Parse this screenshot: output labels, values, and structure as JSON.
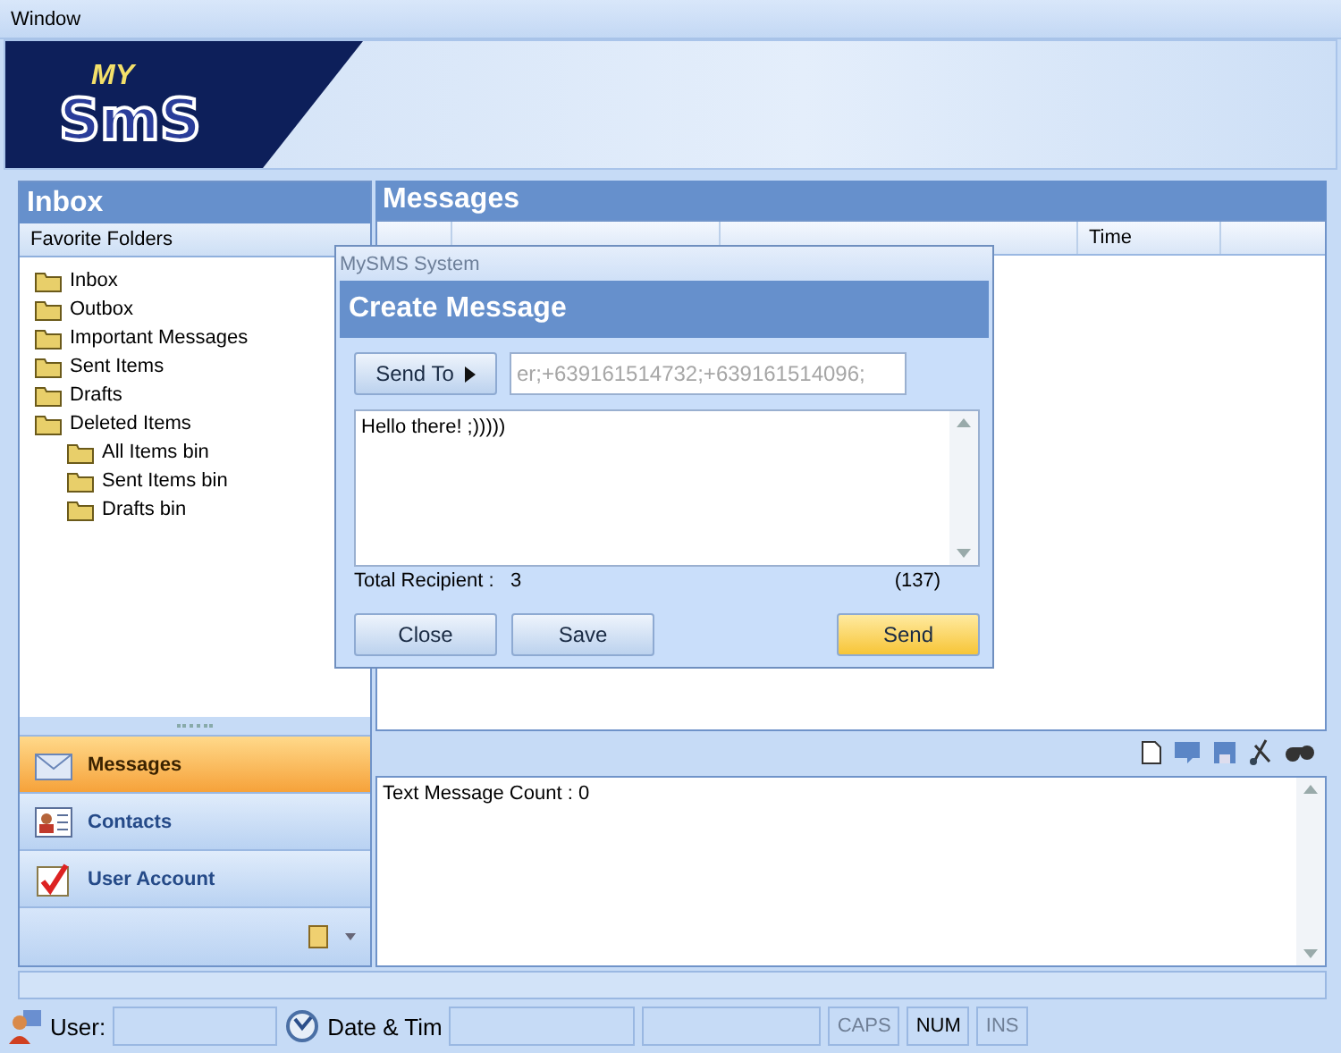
{
  "menu": [
    "Window"
  ],
  "logo": {
    "small": "MY",
    "big": "SmS"
  },
  "left_panel": {
    "title": "Inbox",
    "section": "Favorite Folders",
    "tree": [
      {
        "label": "Inbox"
      },
      {
        "label": "Outbox"
      },
      {
        "label": "Important Messages"
      },
      {
        "label": "Sent Items"
      },
      {
        "label": "Drafts"
      },
      {
        "label": "Deleted Items",
        "children": [
          {
            "label": "All Items bin"
          },
          {
            "label": "Sent Items bin"
          },
          {
            "label": "Drafts bin"
          }
        ]
      }
    ],
    "nav": [
      {
        "label": "Messages",
        "selected": true
      },
      {
        "label": "Contacts",
        "selected": false
      },
      {
        "label": "User Account",
        "selected": false
      }
    ]
  },
  "messages_panel": {
    "title": "Messages",
    "columns": [
      "Time"
    ],
    "log": "Text Message Count : 0"
  },
  "dialog": {
    "title": "MySMS System",
    "header": "Create Message",
    "send_to": "Send To",
    "recipients": "er;+639161514732;+639161514096;",
    "message": "Hello there! ;)))))",
    "total_label": "Total Recipient :",
    "total": "3",
    "remaining": "(137)",
    "buttons": [
      {
        "label": "Close",
        "kind": "normal"
      },
      {
        "label": "Save",
        "kind": "normal"
      },
      {
        "label": "Send",
        "kind": "primary"
      }
    ]
  },
  "status_bar": {
    "user_label": "User:",
    "date_label": "Date & Tim",
    "keys": [
      {
        "label": "CAPS",
        "on": false
      },
      {
        "label": "NUM",
        "on": true
      },
      {
        "label": "INS",
        "on": false
      }
    ]
  }
}
